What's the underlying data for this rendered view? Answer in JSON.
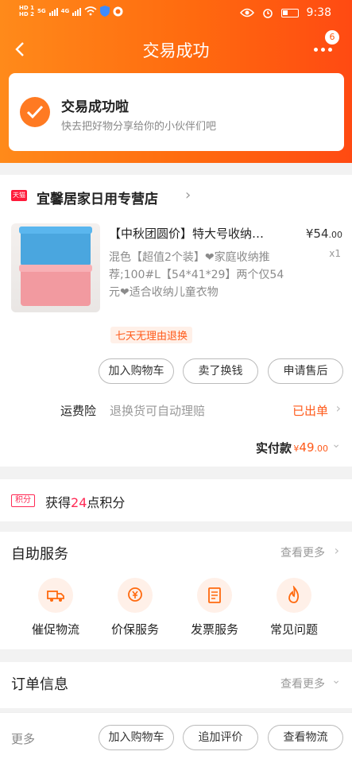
{
  "status_bar": {
    "time": "9:38",
    "sim1": "HD 1",
    "sim2": "HD 2",
    "net1": "5G",
    "net2": "4G"
  },
  "nav": {
    "title": "交易成功",
    "badge_count": "6"
  },
  "success": {
    "title": "交易成功啦",
    "subtitle": "快去把好物分享给你的小伙伴们吧"
  },
  "store": {
    "badge": "天猫",
    "name": "宜馨居家日用专营店"
  },
  "product": {
    "title": "【中秋团圆价】特大号收纳…",
    "price_symbol": "¥",
    "price_int": "54",
    "price_dec": ".00",
    "quantity": "x1",
    "description": "混色【超值2个装】❤家庭收纳推荐;100#L【54*41*29】两个仅54元❤适合收纳儿童衣物",
    "return_tag": "七天无理由退换"
  },
  "actions": {
    "add_to_cart": "加入购物车",
    "resell": "卖了换钱",
    "after_sale": "申请售后"
  },
  "insurance": {
    "label": "运费险",
    "text": "退换货可自动理赔",
    "status": "已出单"
  },
  "payment": {
    "label": "实付款",
    "symbol": "¥",
    "amount_int": "49",
    "amount_dec": ".00"
  },
  "points": {
    "tag": "积分",
    "prefix": "获得",
    "value": "24",
    "suffix": "点积分"
  },
  "self_service": {
    "title": "自助服务",
    "more": "查看更多",
    "items": [
      {
        "label": "催促物流",
        "icon": "delivery-truck-icon"
      },
      {
        "label": "价保服务",
        "icon": "price-protect-icon"
      },
      {
        "label": "发票服务",
        "icon": "invoice-icon"
      },
      {
        "label": "常见问题",
        "icon": "fire-icon"
      }
    ]
  },
  "order_info": {
    "title": "订单信息",
    "more": "查看更多"
  },
  "bottom_bar": {
    "more": "更多",
    "add_to_cart": "加入购物车",
    "add_review": "追加评价",
    "view_logistics": "查看物流"
  },
  "colors": {
    "accent": "#ff6a0f",
    "price": "#ff5a1a",
    "points": "#ff2a55"
  }
}
